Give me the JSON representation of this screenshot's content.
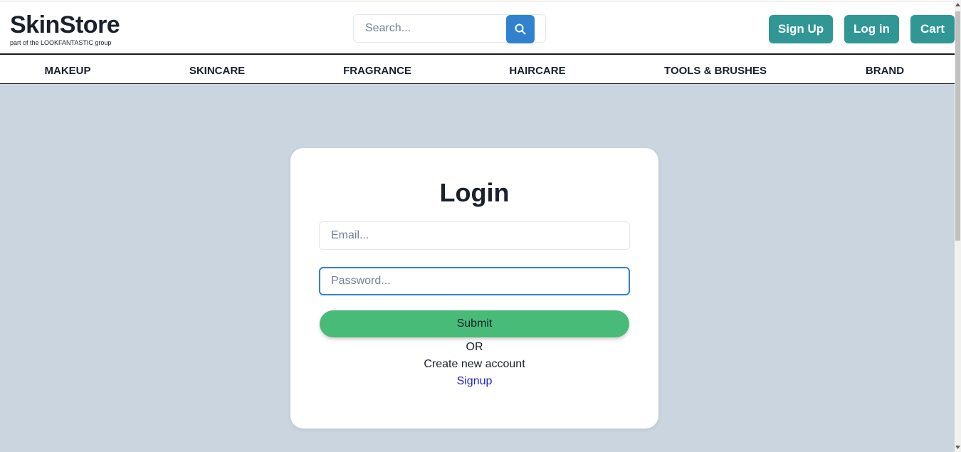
{
  "header": {
    "logo_title": "SkinStore",
    "logo_subtitle": "part of the LOOKFANTASTIC group",
    "search": {
      "placeholder": "Search...",
      "icon": "search-icon"
    },
    "buttons": {
      "signup": "Sign Up",
      "login": "Log in",
      "cart": "Cart"
    }
  },
  "nav": [
    "MAKEUP",
    "SKINCARE",
    "FRAGRANCE",
    "HAIRCARE",
    "TOOLS & BRUSHES",
    "BRAND"
  ],
  "login": {
    "title": "Login",
    "email_placeholder": "Email...",
    "password_placeholder": "Password...",
    "submit": "Submit",
    "or": "OR",
    "create_text": "Create new account",
    "signup_link": "Signup"
  },
  "colors": {
    "accent_teal": "#319795",
    "search_blue": "#3182ce",
    "submit_green": "#48bb78",
    "background": "#cbd5e0",
    "link": "#1e22c8"
  }
}
